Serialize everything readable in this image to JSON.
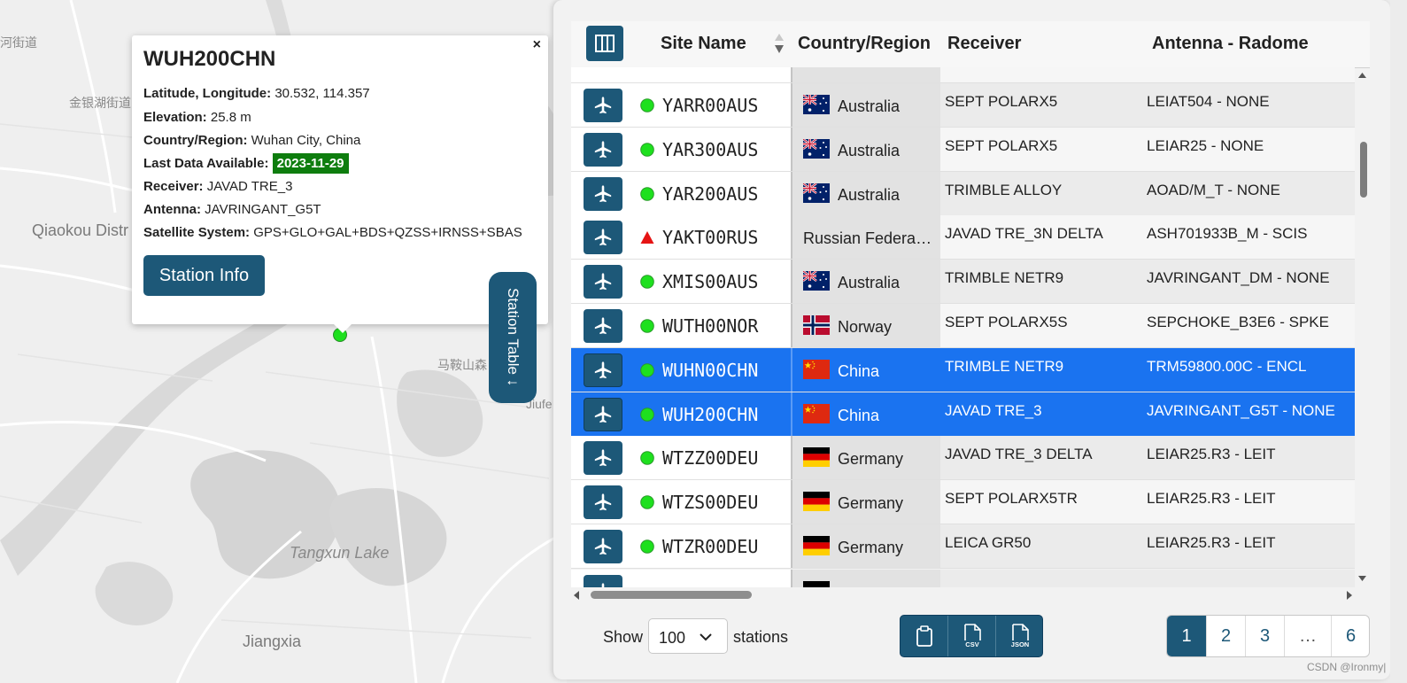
{
  "map": {
    "labels": {
      "jiedao": "河街道",
      "jinyinhu": "金银湖街道",
      "qiaokou": "Qiaokou Distr",
      "maanshan": "马鞍山森",
      "jiufe": "Jiufe",
      "tangxun": "Tangxun Lake",
      "jiangxia": "Jiangxia"
    },
    "marker_icon": "station-marker-green",
    "popup": {
      "title": "WUH200CHN",
      "close": "×",
      "latlon_label": "Latitude, Longitude:",
      "latlon_value": "30.532, 114.357",
      "elevation_label": "Elevation:",
      "elevation_value": "25.8 m",
      "country_label": "Country/Region:",
      "country_value": "Wuhan City, China",
      "lastdata_label": "Last Data Available:",
      "lastdata_value": "2023-11-29",
      "receiver_label": "Receiver:",
      "receiver_value": "JAVAD TRE_3",
      "antenna_label": "Antenna:",
      "antenna_value": "JAVRINGANT_G5T",
      "sat_label": "Satellite System:",
      "sat_value": "GPS+GLO+GAL+BDS+QZSS+IRNSS+SBAS",
      "button": "Station Info"
    },
    "toggle_tab": "Station Table ↓"
  },
  "table": {
    "headers": {
      "site": "Site Name",
      "country": "Country/Region",
      "receiver": "Receiver",
      "antenna": "Antenna - Radome"
    },
    "rows": [
      {
        "site": "YARR00AUS",
        "status": "green",
        "country": "Australia",
        "flag": "AU",
        "receiver": "SEPT POLARX5",
        "antenna": "LEIAT504 - NONE",
        "selected": false
      },
      {
        "site": "YAR300AUS",
        "status": "green",
        "country": "Australia",
        "flag": "AU",
        "receiver": "SEPT POLARX5",
        "antenna": "LEIAR25 - NONE",
        "selected": false
      },
      {
        "site": "YAR200AUS",
        "status": "green",
        "country": "Australia",
        "flag": "AU",
        "receiver": "TRIMBLE ALLOY",
        "antenna": "AOAD/M_T - NONE",
        "selected": false
      },
      {
        "site": "YAKT00RUS",
        "status": "red-triangle",
        "country": "Russian Federa…",
        "flag": "",
        "receiver": "JAVAD TRE_3N DELTA",
        "antenna": "ASH701933B_M - SCIS",
        "selected": false
      },
      {
        "site": "XMIS00AUS",
        "status": "green",
        "country": "Australia",
        "flag": "AU",
        "receiver": "TRIMBLE NETR9",
        "antenna": "JAVRINGANT_DM - NONE",
        "selected": false
      },
      {
        "site": "WUTH00NOR",
        "status": "green",
        "country": "Norway",
        "flag": "NO",
        "receiver": "SEPT POLARX5S",
        "antenna": "SEPCHOKE_B3E6 - SPKE",
        "selected": false
      },
      {
        "site": "WUHN00CHN",
        "status": "green",
        "country": "China",
        "flag": "CN",
        "receiver": "TRIMBLE NETR9",
        "antenna": "TRM59800.00C - ENCL",
        "selected": true
      },
      {
        "site": "WUH200CHN",
        "status": "green",
        "country": "China",
        "flag": "CN",
        "receiver": "JAVAD TRE_3",
        "antenna": "JAVRINGANT_G5T - NONE",
        "selected": true
      },
      {
        "site": "WTZZ00DEU",
        "status": "green",
        "country": "Germany",
        "flag": "DE",
        "receiver": "JAVAD TRE_3 DELTA",
        "antenna": "LEIAR25.R3 - LEIT",
        "selected": false
      },
      {
        "site": "WTZS00DEU",
        "status": "green",
        "country": "Germany",
        "flag": "DE",
        "receiver": "SEPT POLARX5TR",
        "antenna": "LEIAR25.R3 - LEIT",
        "selected": false
      },
      {
        "site": "WTZR00DEU",
        "status": "green",
        "country": "Germany",
        "flag": "DE",
        "receiver": "LEICA GR50",
        "antenna": "LEIAR25.R3 - LEIT",
        "selected": false
      }
    ]
  },
  "footer": {
    "show": "Show",
    "page_size": "100",
    "stations": "stations",
    "export_icons": [
      "clipboard-icon",
      "csv-file-icon",
      "json-file-icon"
    ],
    "export_labels": {
      "csv": "CSV",
      "json": "JSON"
    },
    "pages": [
      "1",
      "2",
      "3",
      "…",
      "6"
    ],
    "active_page": "1"
  },
  "watermark": "CSDN @Ironmy|"
}
